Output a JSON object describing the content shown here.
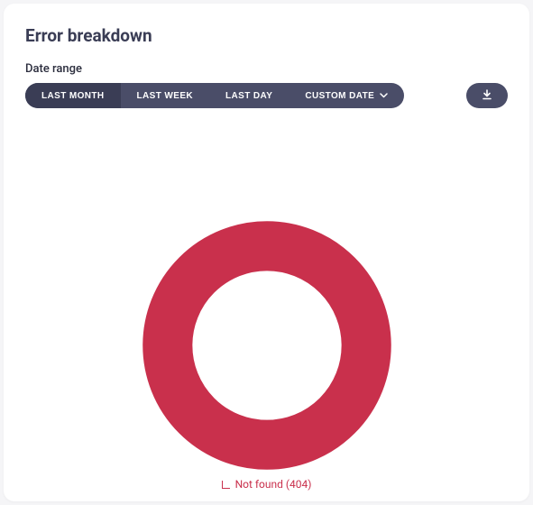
{
  "title": "Error breakdown",
  "range_label": "Date range",
  "segments": {
    "last_month": "LAST MONTH",
    "last_week": "LAST WEEK",
    "last_day": "LAST DAY",
    "custom_date": "CUSTOM DATE"
  },
  "active_segment": "last_month",
  "legend_item": "Not found (404)",
  "colors": {
    "accent": "#c9304c",
    "segment_bg": "#4a4d68",
    "segment_active": "#3a3d55"
  },
  "chart_data": {
    "type": "pie",
    "title": "Error breakdown",
    "series": [
      {
        "name": "Not found (404)",
        "value": 100,
        "color": "#c9304c"
      }
    ]
  }
}
